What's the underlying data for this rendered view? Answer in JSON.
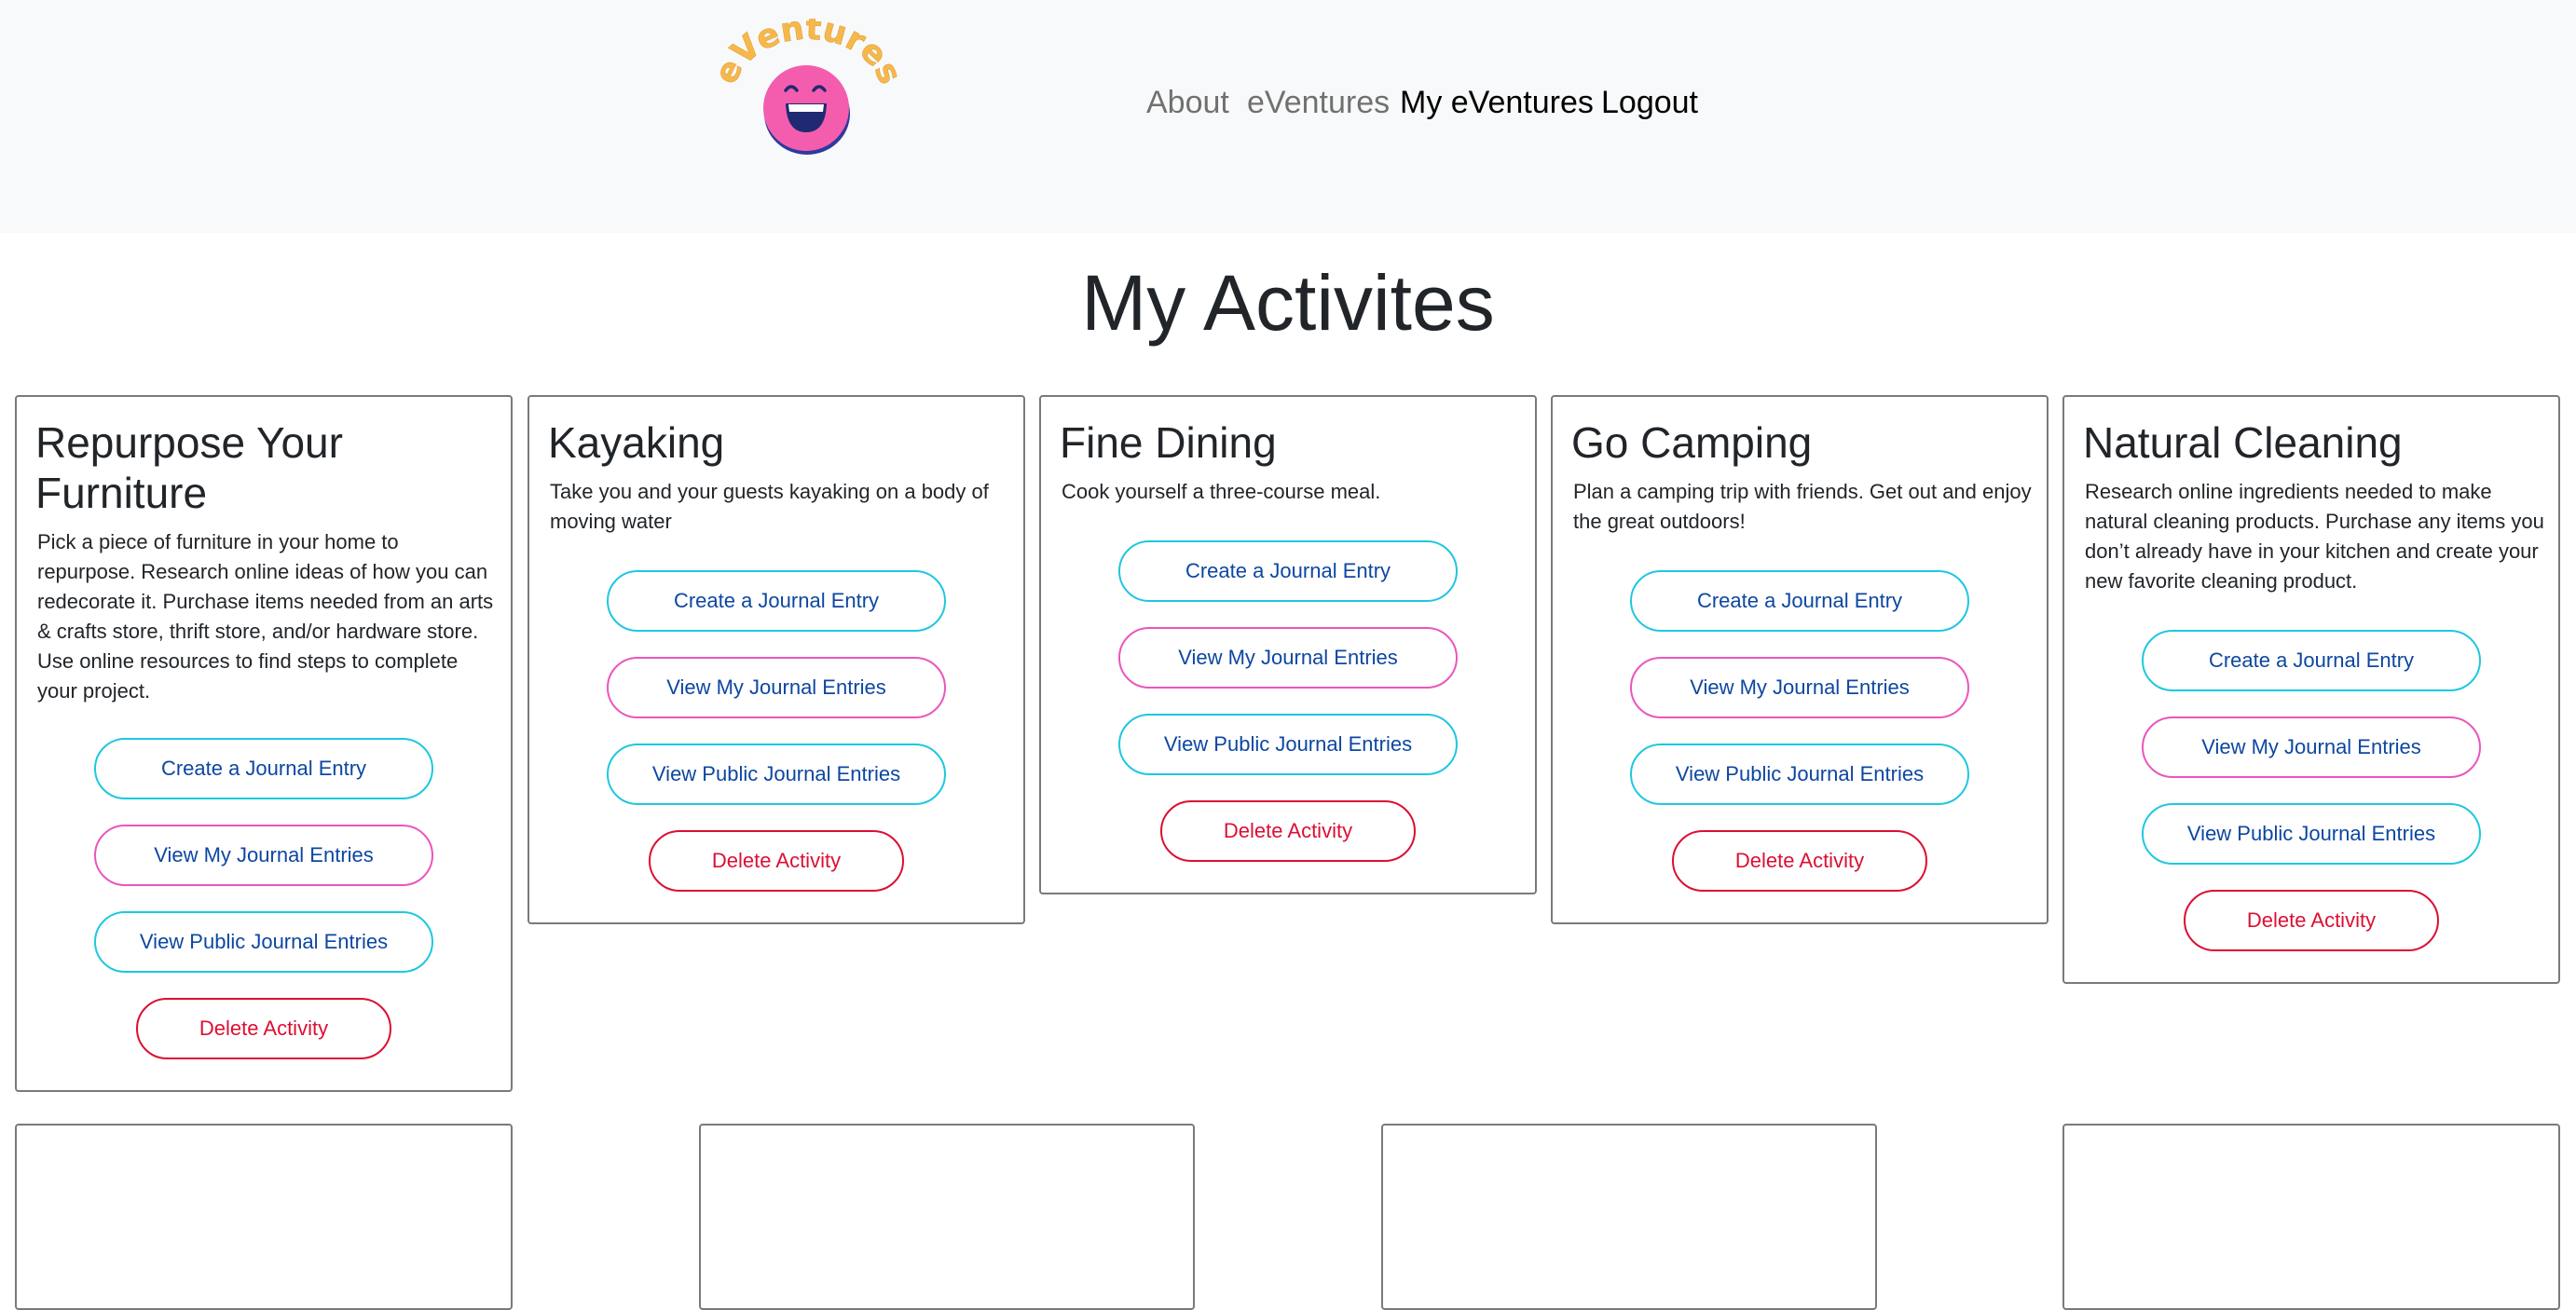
{
  "navbar": {
    "logo_text": "eVentures",
    "links": [
      "About",
      "eVentures",
      "My eVentures",
      "Logout"
    ]
  },
  "page": {
    "title": "My Activites"
  },
  "buttons": {
    "create": "Create a Journal Entry",
    "view_mine": "View My Journal Entries",
    "view_public": "View Public Journal Entries",
    "delete": "Delete Activity"
  },
  "activities": [
    {
      "title": "Repurpose Your Furniture",
      "description": "Pick a piece of furniture in your home to repurpose. Research online ideas of how you can redecorate it. Purchase items needed from an arts & crafts store, thrift store, and/or hardware store. Use online resources to find steps to complete your project."
    },
    {
      "title": "Kayaking",
      "description": "Take you and your guests kayaking on a body of moving water"
    },
    {
      "title": "Fine Dining",
      "description": "Cook yourself a three-course meal."
    },
    {
      "title": "Go Camping",
      "description": "Plan a camping trip with friends. Get out and enjoy the great outdoors!"
    },
    {
      "title": "Natural Cleaning",
      "description": "Research online ingredients needed to make natural cleaning products. Purchase any items you don’t already have in your kitchen and create your new favorite cleaning product."
    }
  ],
  "colors": {
    "navbar_bg": "#f8f9fa",
    "logo_face": "#f45dae",
    "logo_text": "#f7b84b",
    "button_cyan": "#1ec8df",
    "button_pink": "#ea56bd",
    "button_red": "#dc0f34",
    "button_text": "#0d47a1"
  }
}
